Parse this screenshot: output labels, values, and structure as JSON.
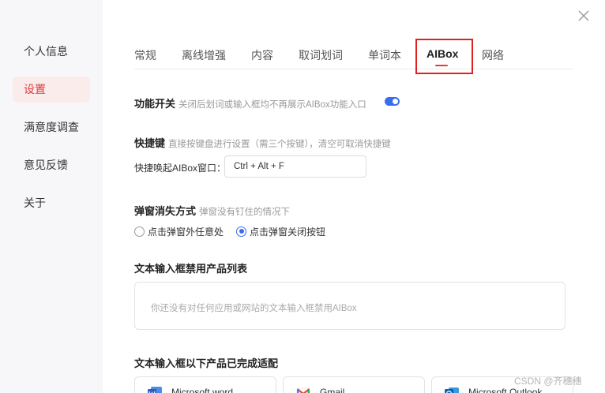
{
  "sidebar": {
    "items": [
      {
        "label": "个人信息"
      },
      {
        "label": "设置"
      },
      {
        "label": "满意度调查"
      },
      {
        "label": "意见反馈"
      },
      {
        "label": "关于"
      }
    ]
  },
  "tabs": [
    {
      "label": "常规"
    },
    {
      "label": "离线增强"
    },
    {
      "label": "内容"
    },
    {
      "label": "取词划词"
    },
    {
      "label": "单词本"
    },
    {
      "label": "AIBox"
    },
    {
      "label": "网络"
    }
  ],
  "feature_switch": {
    "title": "功能开关",
    "desc": "关闭后划词或输入框均不再展示AIBox功能入口",
    "enabled": true
  },
  "hotkey": {
    "title": "快捷键",
    "desc": "直接按键盘进行设置（需三个按键），清空可取消快捷键",
    "label": "快捷唤起AIBox窗口：",
    "value": "Ctrl + Alt + F"
  },
  "dismiss": {
    "title": "弹窗消失方式",
    "desc": "弹窗没有钉住的情况下",
    "options": [
      {
        "label": "点击弹窗外任意处",
        "checked": false
      },
      {
        "label": "点击弹窗关闭按钮",
        "checked": true
      }
    ]
  },
  "disabled_list": {
    "title": "文本输入框禁用产品列表",
    "empty_text": "你还没有对任何应用或网站的文本输入框禁用AIBox"
  },
  "adapted": {
    "title": "文本输入框以下产品已完成适配",
    "apps": [
      {
        "name": "Microsoft word",
        "icon": "word-icon"
      },
      {
        "name": "Gmail",
        "icon": "gmail-icon"
      },
      {
        "name": "Microsoft Outlook",
        "icon": "outlook-icon"
      }
    ]
  },
  "watermark": "CSDN @齐穗穗"
}
